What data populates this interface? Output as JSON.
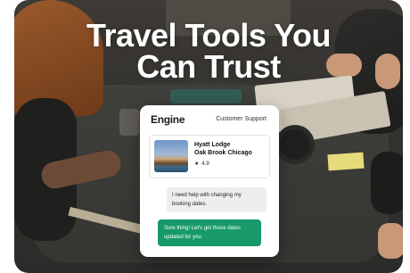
{
  "hero": {
    "headline_line1": "Travel Tools You",
    "headline_line2": "Can Trust"
  },
  "card": {
    "logo": "Engine",
    "header_label": "Customer Support",
    "hotel": {
      "name_line1": "Hyatt Lodge",
      "name_line2": "Oak Brook Chicago",
      "rating": "4.9",
      "rating_icon": "star-icon"
    },
    "messages": [
      {
        "from": "user",
        "text": "I need help with changing my booking dates."
      },
      {
        "from": "agent",
        "text": "Sure thing! Let's get those dates updated for you."
      }
    ]
  },
  "colors": {
    "agent_bubble": "#17996a",
    "user_bubble": "#eeeeec",
    "headline": "#ffffff"
  }
}
